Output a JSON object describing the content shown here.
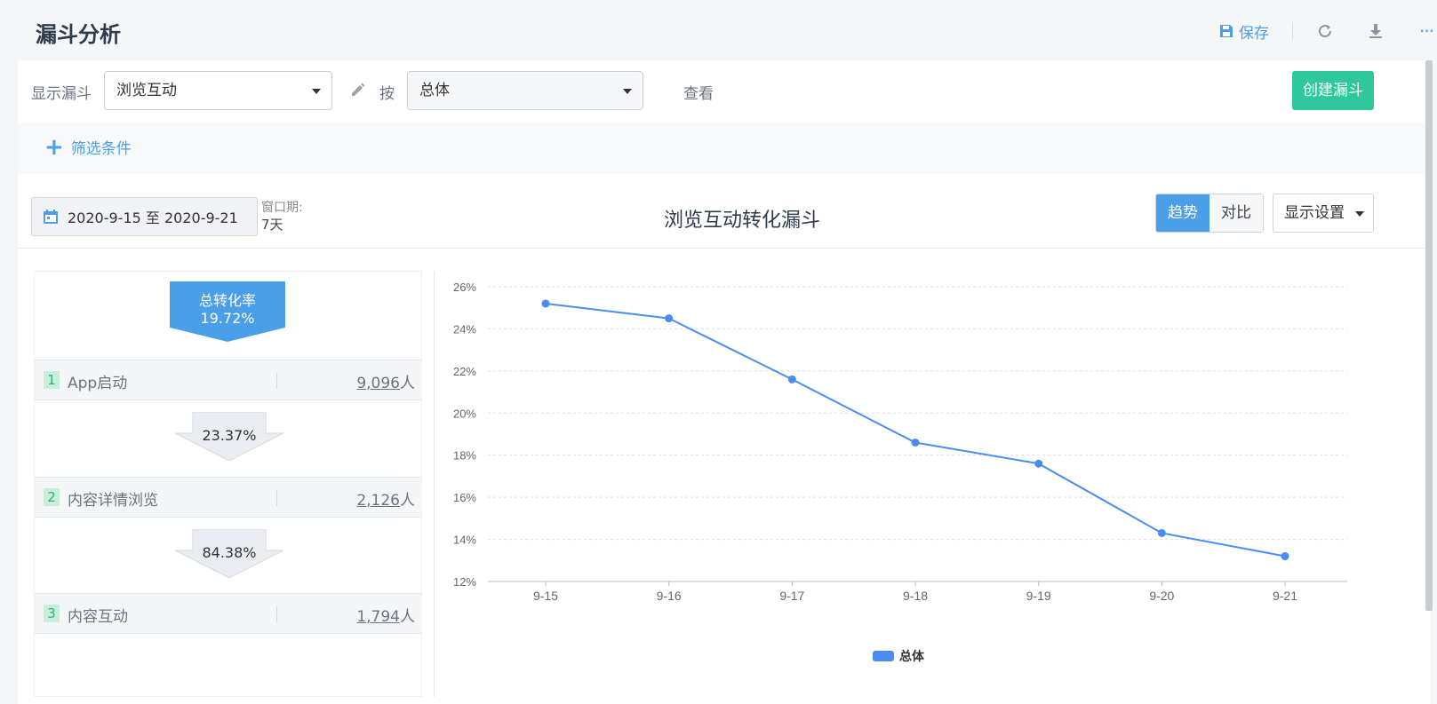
{
  "header": {
    "title": "漏斗分析",
    "save_label": "保存",
    "more_label": "···"
  },
  "toolbar": {
    "show_funnel_label": "显示漏斗",
    "funnel_select_value": "浏览互动",
    "by_label": "按",
    "group_select_value": "总体",
    "view_label": "查看",
    "create_button": "创建漏斗"
  },
  "filter": {
    "add_label": "筛选条件"
  },
  "controls": {
    "date_range": "2020-9-15 至 2020-9-21",
    "window_label": "窗口期:",
    "window_value": "7天",
    "chart_title": "浏览互动转化漏斗",
    "tab_trend": "趋势",
    "tab_compare": "对比",
    "display_settings": "显示设置"
  },
  "funnel": {
    "total_label": "总转化率",
    "total_rate": "19.72%",
    "steps": [
      {
        "index": "1",
        "name": "App启动",
        "count": "9,096",
        "unit": "人"
      },
      {
        "index": "2",
        "name": "内容详情浏览",
        "count": "2,126",
        "unit": "人"
      },
      {
        "index": "3",
        "name": "内容互动",
        "count": "1,794",
        "unit": "人"
      }
    ],
    "rates": [
      "23.37%",
      "84.38%"
    ]
  },
  "colors": {
    "accent": "#4b9fe8",
    "create": "#2fc89a",
    "line": "#4a8cf2"
  },
  "chart_data": {
    "type": "line",
    "x": [
      "9-15",
      "9-16",
      "9-17",
      "9-18",
      "9-19",
      "9-20",
      "9-21"
    ],
    "series": [
      {
        "name": "总体",
        "values": [
          25.2,
          24.5,
          21.6,
          18.6,
          17.6,
          14.3,
          13.2
        ]
      }
    ],
    "yticks": [
      "12%",
      "14%",
      "16%",
      "18%",
      "20%",
      "22%",
      "24%",
      "26%"
    ],
    "ylim": [
      12,
      26
    ],
    "grid": true,
    "legend": "bottom"
  }
}
